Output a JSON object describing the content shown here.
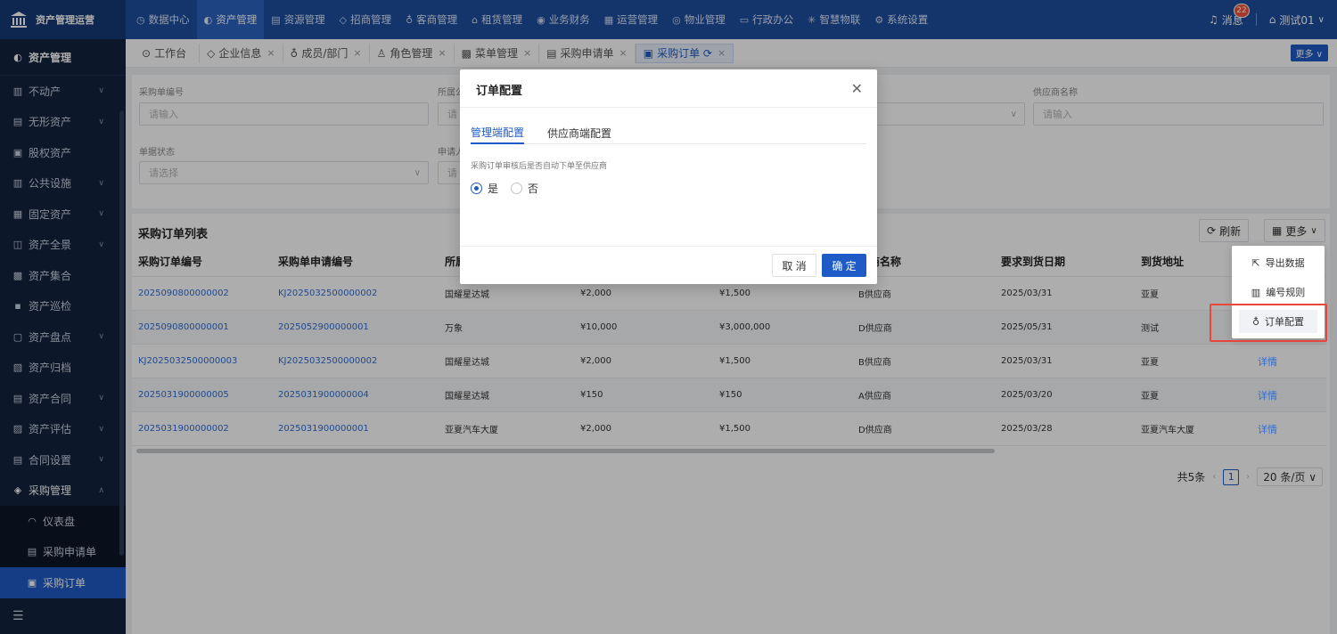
{
  "brand": {
    "title": "资产管理运营"
  },
  "topnav": [
    {
      "icon": "◷",
      "label": "数据中心"
    },
    {
      "icon": "◐",
      "label": "资产管理",
      "active": true
    },
    {
      "icon": "▤",
      "label": "资源管理"
    },
    {
      "icon": "◇",
      "label": "招商管理"
    },
    {
      "icon": "♁",
      "label": "客商管理"
    },
    {
      "icon": "⌂",
      "label": "租赁管理"
    },
    {
      "icon": "◉",
      "label": "业务财务"
    },
    {
      "icon": "▦",
      "label": "运营管理"
    },
    {
      "icon": "◎",
      "label": "物业管理"
    },
    {
      "icon": "▭",
      "label": "行政办公"
    },
    {
      "icon": "✳",
      "label": "智慧物联"
    },
    {
      "icon": "⚙",
      "label": "系统设置"
    }
  ],
  "topright": {
    "messages_label": "消息",
    "messages_count": "22",
    "user": "测试01"
  },
  "sidebar": {
    "head": "资产管理",
    "items": [
      {
        "icon": "▥",
        "label": "不动产",
        "chev": "∨"
      },
      {
        "icon": "▤",
        "label": "无形资产",
        "chev": "∨"
      },
      {
        "icon": "▣",
        "label": "股权资产",
        "chev": ""
      },
      {
        "icon": "▥",
        "label": "公共设施",
        "chev": "∨"
      },
      {
        "icon": "▦",
        "label": "固定资产",
        "chev": "∨"
      },
      {
        "icon": "◫",
        "label": "资产全景",
        "chev": "∨"
      },
      {
        "icon": "▩",
        "label": "资产集合",
        "chev": ""
      },
      {
        "icon": "▪",
        "label": "资产巡检",
        "chev": ""
      },
      {
        "icon": "▢",
        "label": "资产盘点",
        "chev": "∨"
      },
      {
        "icon": "▧",
        "label": "资产归档",
        "chev": ""
      },
      {
        "icon": "▤",
        "label": "资产合同",
        "chev": "∨"
      },
      {
        "icon": "▨",
        "label": "资产评估",
        "chev": "∨"
      },
      {
        "icon": "▤",
        "label": "合同设置",
        "chev": "∨"
      },
      {
        "icon": "◈",
        "label": "采购管理",
        "chev": "∧"
      }
    ],
    "subitems": [
      {
        "icon": "◠",
        "label": "仪表盘"
      },
      {
        "icon": "▤",
        "label": "采购申请单"
      },
      {
        "icon": "▣",
        "label": "采购订单",
        "active": true
      }
    ]
  },
  "tabs": [
    {
      "icon": "⊙",
      "label": "工作台",
      "close": ""
    },
    {
      "icon": "◇",
      "label": "企业信息",
      "close": "×"
    },
    {
      "icon": "♁",
      "label": "成员/部门",
      "close": "×"
    },
    {
      "icon": "♙",
      "label": "角色管理",
      "close": "×"
    },
    {
      "icon": "▩",
      "label": "菜单管理",
      "close": "×"
    },
    {
      "icon": "▤",
      "label": "采购申请单",
      "close": "×"
    },
    {
      "icon": "▣",
      "label": "采购订单 ⟳",
      "close": "×",
      "active": true
    }
  ],
  "tabs_more": "更多 ∨",
  "filter": {
    "order_no_label": "采购单编号",
    "order_no_placeholder": "请输入",
    "owner_label": "所属公",
    "owner_placeholder": "请",
    "supplier_label": "供应商名称",
    "supplier_placeholder": "请输入",
    "status_label": "单据状态",
    "status_placeholder": "请选择",
    "applicant_label": "申请人",
    "applicant_placeholder": "请"
  },
  "panel": {
    "title": "采购订单列表",
    "refresh": "刷新",
    "more": "更多",
    "columns": [
      "采购订单编号",
      "采购单申请编号",
      "所属",
      "",
      "",
      "应商名称",
      "要求到货日期",
      "到货地址"
    ],
    "rows": [
      [
        "2025090800000002",
        "KJ2025032500000002",
        "国耀星达城",
        "¥2,000",
        "¥1,500",
        "B供应商",
        "2025/03/31",
        "亚夏"
      ],
      [
        "2025090800000001",
        "2025052900000001",
        "万象",
        "¥10,000",
        "¥3,000,000",
        "D供应商",
        "2025/05/31",
        "测试"
      ],
      [
        "KJ2025032500000003",
        "KJ2025032500000002",
        "国耀星达城",
        "¥2,000",
        "¥1,500",
        "B供应商",
        "2025/03/31",
        "亚夏"
      ],
      [
        "2025031900000005",
        "2025031900000004",
        "国耀星达城",
        "¥150",
        "¥150",
        "A供应商",
        "2025/03/20",
        "亚夏"
      ],
      [
        "2025031900000002",
        "2025031900000001",
        "亚夏汽车大厦",
        "¥2,000",
        "¥1,500",
        "D供应商",
        "2025/03/28",
        "亚夏汽车大厦"
      ]
    ],
    "detail_label": "详情",
    "total": "共5条",
    "page": "1",
    "page_size": "20 条/页 ∨"
  },
  "modal": {
    "title": "订单配置",
    "tab_admin": "管理端配置",
    "tab_supplier": "供应商端配置",
    "question": "采购订单审核后是否自动下单至供应商",
    "yes": "是",
    "no": "否",
    "cancel": "取 消",
    "ok": "确 定"
  },
  "dropdown": {
    "export": "导出数据",
    "numbering": "编号规则",
    "order_config": "订单配置"
  }
}
